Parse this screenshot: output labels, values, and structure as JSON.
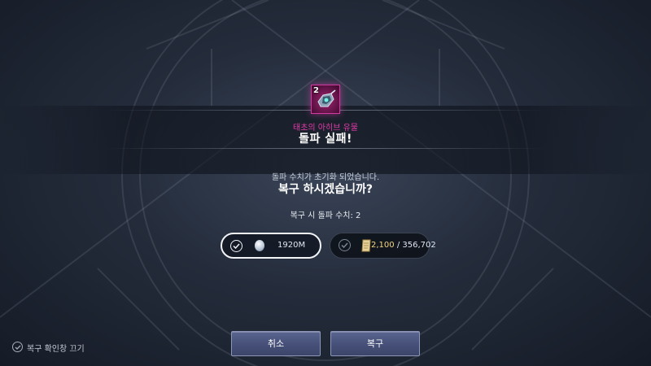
{
  "item": {
    "count": "2",
    "name": "태초의 아히브 유물",
    "icon": "relic-item-icon"
  },
  "result": {
    "title": "돌파 실패!"
  },
  "prompt": {
    "reset_note": "돌파 수치가 초기화 되었습니다.",
    "question": "복구 하시겠습니까?",
    "restore_value": "복구 시 돌파 수치: 2"
  },
  "options": {
    "silver": {
      "icon": "silver-coin-icon",
      "amount": "1920M",
      "selected": true
    },
    "scroll": {
      "icon": "scroll-icon",
      "have": "2,100",
      "separator": " / ",
      "need": "356,702",
      "selected": false
    }
  },
  "buttons": {
    "cancel": "취소",
    "restore": "복구"
  },
  "footer": {
    "disable_confirm": "복구 확인창 끄기"
  },
  "colors": {
    "item_name": "#e43aa8",
    "button": "#4a547d",
    "scroll_have": "#f2d680"
  }
}
